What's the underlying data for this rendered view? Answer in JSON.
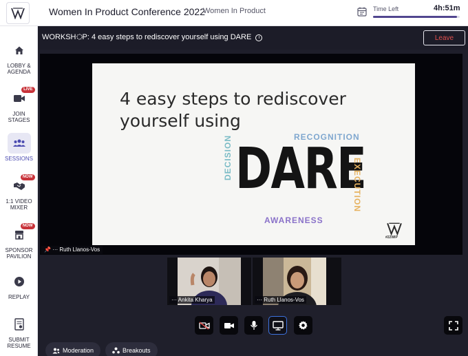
{
  "header": {
    "title": "Women In Product Conference 2022",
    "org": "Women In Product",
    "time_left_label": "Time Left",
    "time_left_value": "4h:51m",
    "time_progress": 0.97
  },
  "sidebar": {
    "items": [
      {
        "label1": "LOBBY &",
        "label2": "AGENDA",
        "icon": "home-icon"
      },
      {
        "label1": "JOIN",
        "label2": "STAGES",
        "icon": "video-camera-icon",
        "badge": "LIVE"
      },
      {
        "label1": "SESSIONS",
        "label2": "",
        "icon": "people-group-icon",
        "active": true
      },
      {
        "label1": "1:1 VIDEO",
        "label2": "MIXER",
        "icon": "handshake-icon",
        "badge": "NOW"
      },
      {
        "label1": "SPONSOR",
        "label2": "PAVILION",
        "icon": "storefront-icon",
        "badge": "NOW"
      },
      {
        "label1": "REPLAY",
        "label2": "",
        "icon": "play-circle-icon"
      },
      {
        "label1": "SUBMIT",
        "label2": "RESUME",
        "icon": "resume-document-icon"
      }
    ]
  },
  "stage": {
    "workshop_title_a": "WORKSH",
    "workshop_title_b": "P: 4 easy steps to rediscover yourself using DARE",
    "leave_label": "Leave",
    "presenter_name": "Ruth Llanos-Vos"
  },
  "slide": {
    "title_line1": "4 easy steps to rediscover",
    "title_line2": "yourself using",
    "big_word": "DARE",
    "word_recognition": "RECOGNITION",
    "word_awareness": "AWARENESS",
    "word_decision": "DECISION",
    "word_execution": "EXECUTION",
    "tag": "#22WIP"
  },
  "participants": [
    {
      "name": "Ankita Kharya"
    },
    {
      "name": "Ruth Llanos-Vos"
    }
  ],
  "controls": {
    "camera_off": "camera-off-icon",
    "camera": "video-camera-icon",
    "mic": "microphone-icon",
    "screen": "screen-share-icon",
    "settings": "gear-icon",
    "fullscreen": "fullscreen-icon"
  },
  "bottom": {
    "moderation_label": "Moderation",
    "breakouts_label": "Breakouts"
  },
  "colors": {
    "accent": "#51468f",
    "leave": "#e0504e",
    "badge": "#c8333a",
    "active_control": "#3d73e0"
  }
}
